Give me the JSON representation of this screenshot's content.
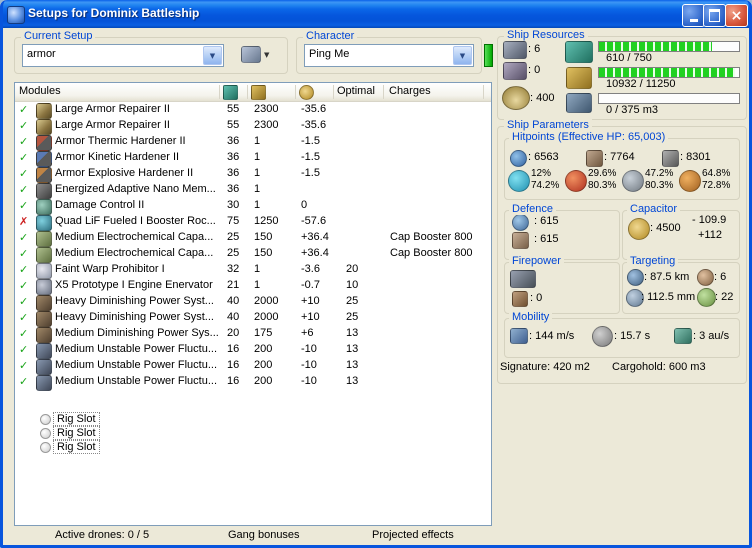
{
  "window": {
    "title": "Setups for Dominix Battleship"
  },
  "setup": {
    "label": "Current Setup",
    "value": "armor"
  },
  "character": {
    "label": "Character",
    "value": "Ping Me"
  },
  "table": {
    "header": {
      "modules": "Modules",
      "optimal": "Optimal",
      "charges": "Charges"
    },
    "header_icons": [
      "cpu",
      "powergrid",
      "capacitor"
    ],
    "rows": [
      {
        "status": "ok",
        "icon": "armor-repairer",
        "name": "Large Armor Repairer II",
        "cpu": "55",
        "pg": "2300",
        "cap": "-35.6",
        "optimal": "",
        "charges": ""
      },
      {
        "status": "ok",
        "icon": "armor-repairer",
        "name": "Large Armor Repairer II",
        "cpu": "55",
        "pg": "2300",
        "cap": "-35.6",
        "optimal": "",
        "charges": ""
      },
      {
        "status": "ok",
        "icon": "thermic-hardener",
        "name": "Armor Thermic Hardener II",
        "cpu": "36",
        "pg": "1",
        "cap": "-1.5",
        "optimal": "",
        "charges": ""
      },
      {
        "status": "ok",
        "icon": "kinetic-hardener",
        "name": "Armor Kinetic Hardener II",
        "cpu": "36",
        "pg": "1",
        "cap": "-1.5",
        "optimal": "",
        "charges": ""
      },
      {
        "status": "ok",
        "icon": "explosive-hardener",
        "name": "Armor Explosive Hardener II",
        "cpu": "36",
        "pg": "1",
        "cap": "-1.5",
        "optimal": "",
        "charges": ""
      },
      {
        "status": "ok",
        "icon": "nano-membrane",
        "name": "Energized Adaptive Nano Mem...",
        "cpu": "36",
        "pg": "1",
        "cap": "",
        "optimal": "",
        "charges": ""
      },
      {
        "status": "ok",
        "icon": "damage-control",
        "name": "Damage Control II",
        "cpu": "30",
        "pg": "1",
        "cap": "0",
        "optimal": "",
        "charges": ""
      },
      {
        "status": "error",
        "icon": "booster-rocket",
        "name": "Quad LiF Fueled I Booster Roc...",
        "cpu": "75",
        "pg": "1250",
        "cap": "-57.6",
        "optimal": "",
        "charges": ""
      },
      {
        "status": "ok",
        "icon": "cap-booster",
        "name": "Medium Electrochemical Capa...",
        "cpu": "25",
        "pg": "150",
        "cap": "+36.4",
        "optimal": "",
        "charges": "Cap Booster 800"
      },
      {
        "status": "ok",
        "icon": "cap-booster",
        "name": "Medium Electrochemical Capa...",
        "cpu": "25",
        "pg": "150",
        "cap": "+36.4",
        "optimal": "",
        "charges": "Cap Booster 800"
      },
      {
        "status": "ok",
        "icon": "warp-prohibitor",
        "name": "Faint Warp Prohibitor I",
        "cpu": "32",
        "pg": "1",
        "cap": "-3.6",
        "optimal": "20",
        "charges": ""
      },
      {
        "status": "ok",
        "icon": "stasis-web",
        "name": "X5 Prototype I Engine Enervator",
        "cpu": "21",
        "pg": "1",
        "cap": "-0.7",
        "optimal": "10",
        "charges": ""
      },
      {
        "status": "ok",
        "icon": "nosferatu",
        "name": "Heavy Diminishing Power Syst...",
        "cpu": "40",
        "pg": "2000",
        "cap": "+10",
        "optimal": "25",
        "charges": ""
      },
      {
        "status": "ok",
        "icon": "nosferatu",
        "name": "Heavy Diminishing Power Syst...",
        "cpu": "40",
        "pg": "2000",
        "cap": "+10",
        "optimal": "25",
        "charges": ""
      },
      {
        "status": "ok",
        "icon": "nosferatu",
        "name": "Medium Diminishing Power Sys...",
        "cpu": "20",
        "pg": "175",
        "cap": "+6",
        "optimal": "13",
        "charges": ""
      },
      {
        "status": "ok",
        "icon": "energy-neutralizer",
        "name": "Medium Unstable Power Fluctu...",
        "cpu": "16",
        "pg": "200",
        "cap": "-10",
        "optimal": "13",
        "charges": ""
      },
      {
        "status": "ok",
        "icon": "energy-neutralizer",
        "name": "Medium Unstable Power Fluctu...",
        "cpu": "16",
        "pg": "200",
        "cap": "-10",
        "optimal": "13",
        "charges": ""
      },
      {
        "status": "ok",
        "icon": "energy-neutralizer",
        "name": "Medium Unstable Power Fluctu...",
        "cpu": "16",
        "pg": "200",
        "cap": "-10",
        "optimal": "13",
        "charges": ""
      },
      {
        "status": "rig",
        "name": "Rig Slot"
      },
      {
        "status": "rig",
        "name": "Rig Slot"
      },
      {
        "status": "rig",
        "name": "Rig Slot"
      }
    ]
  },
  "bottom": {
    "active_drones": "Active drones: 0 / 5",
    "gang_bonuses": "Gang bonuses",
    "projected_effects": "Projected effects"
  },
  "resources": {
    "label": "Ship Resources",
    "turrets": "6",
    "launchers": "0",
    "calibration": "400",
    "cpu": {
      "text": "610 / 750",
      "pct": 81
    },
    "powergrid": {
      "text": "10932 / 11250",
      "pct": 97
    },
    "dronebay": {
      "text": "0 / 375 m3",
      "pct": 0
    }
  },
  "parameters": {
    "label": "Ship Parameters",
    "hitpoints": {
      "label": "Hitpoints (Effective HP: 65,003)",
      "shield": "6563",
      "armor": "7764",
      "structure": "8301",
      "resists": [
        {
          "type": "em",
          "shield": "12%",
          "armor": "74.2%"
        },
        {
          "type": "thermal",
          "shield": "29.6%",
          "armor": "80.3%"
        },
        {
          "type": "kinetic",
          "shield": "47.2%",
          "armor": "80.3%"
        },
        {
          "type": "explosive",
          "shield": "64.8%",
          "armor": "72.8%"
        }
      ]
    },
    "defence": {
      "label": "Defence",
      "value1": "615",
      "value2": "615"
    },
    "capacitor": {
      "label": "Capacitor",
      "amount": "4500",
      "drain": "- 109.9",
      "recharge": "+112"
    },
    "firepower": {
      "label": "Firepower",
      "volley": "",
      "dps": "0"
    },
    "targeting": {
      "label": "Targeting",
      "range": "87.5 km",
      "max_targets": "6",
      "scan_resolution": "112.5 mm",
      "sensor_strength": "22"
    },
    "mobility": {
      "label": "Mobility",
      "speed": "144 m/s",
      "align_time": "15.7 s",
      "warp_speed": "3 au/s"
    },
    "signature": "Signature: 420 m2",
    "cargohold": "Cargohold: 600 m3"
  }
}
